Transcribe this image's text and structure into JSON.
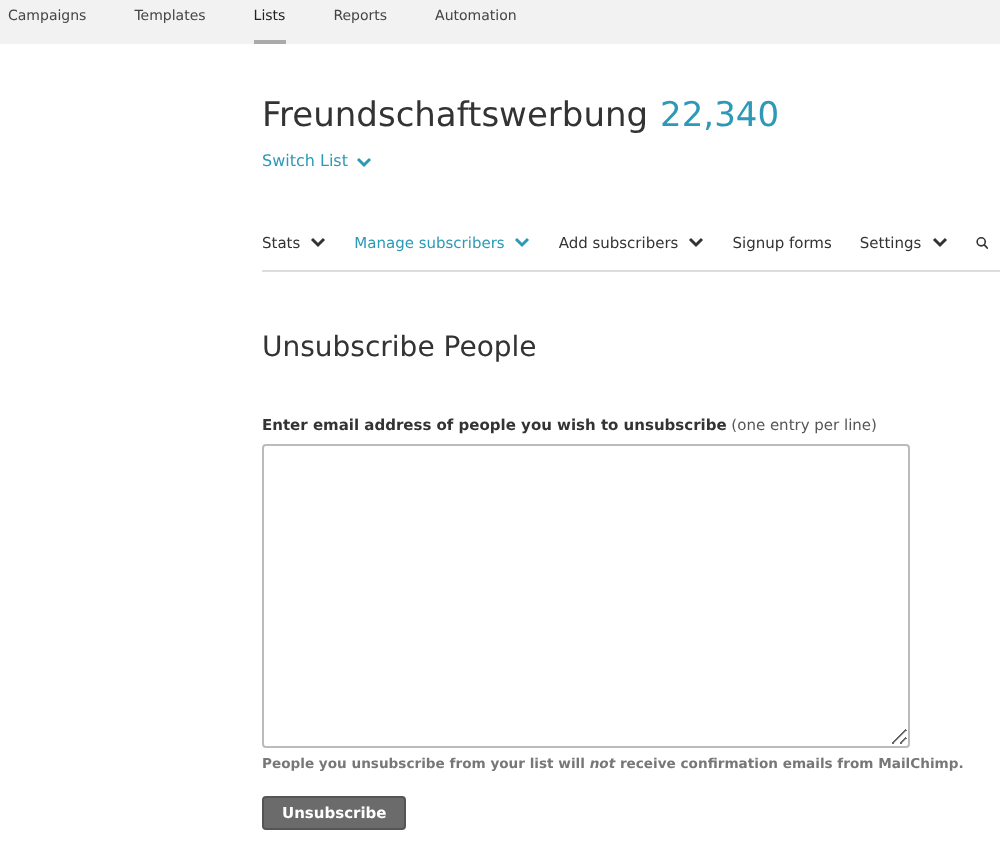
{
  "top_nav": [
    {
      "label": "Campaigns",
      "selected": false
    },
    {
      "label": "Templates",
      "selected": false
    },
    {
      "label": "Lists",
      "selected": true
    },
    {
      "label": "Reports",
      "selected": false
    },
    {
      "label": "Automation",
      "selected": false
    }
  ],
  "list": {
    "name": "Freundschaftswerbung",
    "count": "22,340",
    "switch_label": "Switch List"
  },
  "tabs": [
    {
      "label": "Stats",
      "selected": false,
      "has_menu": true
    },
    {
      "label": "Manage subscribers",
      "selected": true,
      "has_menu": true
    },
    {
      "label": "Add subscribers",
      "selected": false,
      "has_menu": true
    },
    {
      "label": "Signup forms",
      "selected": false,
      "has_menu": false
    },
    {
      "label": "Settings",
      "selected": false,
      "has_menu": true
    }
  ],
  "heading": "Unsubscribe People",
  "field_label": "**Enter email address of people you wish to unsubscribe** (one entry per line)",
  "note": "People you unsubscribe from your list will *not* receive confirmation emails from MailChimp.",
  "button": "Unsubscribe"
}
